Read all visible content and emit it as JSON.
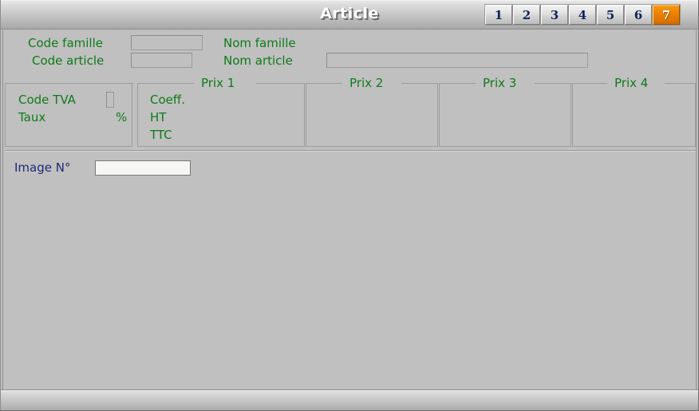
{
  "window": {
    "title": "Article"
  },
  "tabs": [
    {
      "label": "1",
      "active": false
    },
    {
      "label": "2",
      "active": false
    },
    {
      "label": "3",
      "active": false
    },
    {
      "label": "4",
      "active": false
    },
    {
      "label": "5",
      "active": false
    },
    {
      "label": "6",
      "active": false
    },
    {
      "label": "7",
      "active": true
    }
  ],
  "header_fields": {
    "code_famille_label": "Code famille",
    "code_famille_value": "",
    "nom_famille_label": "Nom famille",
    "nom_famille_value": "",
    "code_article_label": "Code article",
    "code_article_value": "",
    "nom_article_label": "Nom article",
    "nom_article_value": ""
  },
  "tva_panel": {
    "code_tva_label": "Code TVA",
    "code_tva_value": "",
    "taux_label": "Taux",
    "taux_value": "",
    "percent_symbol": "%"
  },
  "price_groups": [
    {
      "legend": "Prix 1",
      "rows": [
        {
          "label": "Coeff.",
          "value": ""
        },
        {
          "label": "HT",
          "value": ""
        },
        {
          "label": "TTC",
          "value": ""
        }
      ]
    },
    {
      "legend": "Prix 2",
      "rows": []
    },
    {
      "legend": "Prix 3",
      "rows": []
    },
    {
      "legend": "Prix 4",
      "rows": []
    }
  ],
  "image_section": {
    "label": "Image N°",
    "value": ""
  },
  "status_bar": {
    "text": ""
  },
  "colors": {
    "background": "#c0c0c0",
    "label_green": "#0f7a18",
    "label_active_blue": "#1b2a78",
    "tab_active_orange": "#ef8500",
    "field_editable_bg": "#f6f6f4"
  }
}
